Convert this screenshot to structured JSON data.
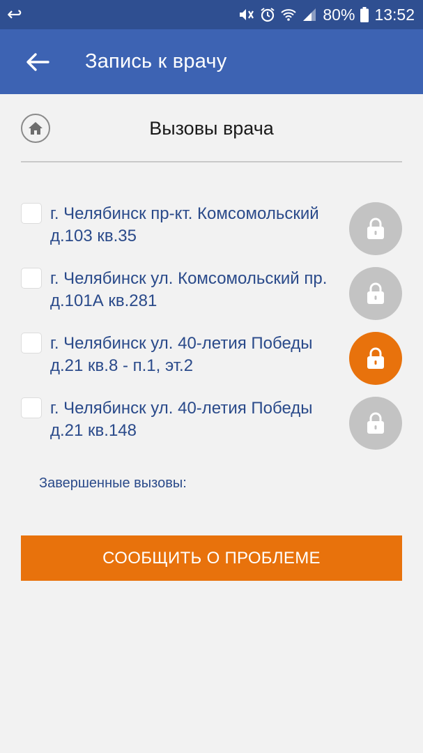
{
  "status_bar": {
    "battery": "80%",
    "time": "13:52",
    "icons": [
      "back-swipe-icon",
      "mute-icon",
      "alarm-icon",
      "wifi-icon",
      "signal-icon",
      "battery-icon"
    ]
  },
  "app_bar": {
    "title": "Запись к врачу",
    "back_icon": "arrow-left-icon",
    "color": "#3d63b3"
  },
  "page": {
    "title": "Вызовы врача",
    "home_icon": "home-icon"
  },
  "calls": [
    {
      "address": "г. Челябинск пр-кт. Комсомольский д.103 кв.35",
      "checked": false,
      "lock_state": "inactive",
      "lock_color": "#c3c3c3"
    },
    {
      "address": "г. Челябинск ул. Комсомольский пр. д.101А кв.281",
      "checked": false,
      "lock_state": "inactive",
      "lock_color": "#c3c3c3"
    },
    {
      "address": "г. Челябинск ул. 40-летия Победы д.21 кв.8 - п.1, эт.2",
      "checked": false,
      "lock_state": "active",
      "lock_color": "#e8720c"
    },
    {
      "address": "г. Челябинск ул. 40-летия Победы д.21 кв.148",
      "checked": false,
      "lock_state": "inactive",
      "lock_color": "#c3c3c3"
    }
  ],
  "completed": {
    "label": "Завершенные вызовы:"
  },
  "report_button": {
    "label": "СООБЩИТЬ О ПРОБЛЕМЕ",
    "color": "#e8720c"
  }
}
